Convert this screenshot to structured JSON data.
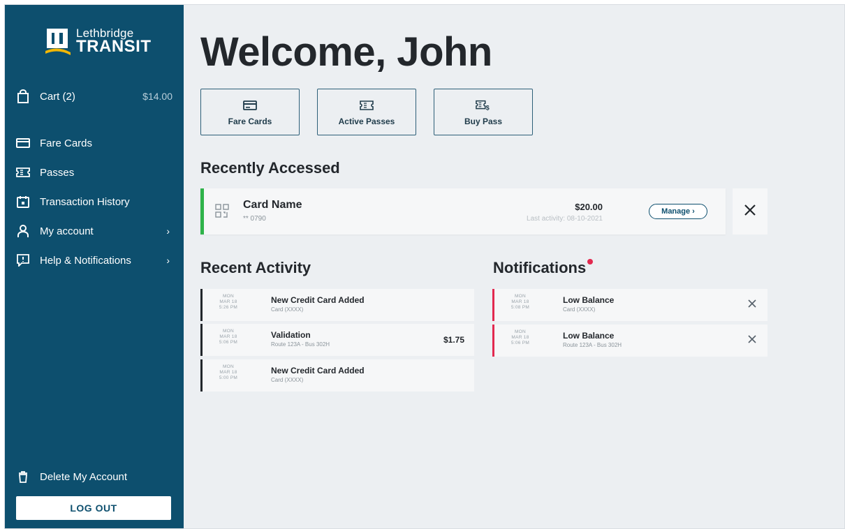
{
  "brand": {
    "logo_top": "Lethbridge",
    "logo_bottom": "TRANSIT",
    "primary_color": "#0d4f6e",
    "accent_yellow": "#f2b705"
  },
  "sidebar": {
    "cart": {
      "label": "Cart (2)",
      "amount": "$14.00",
      "icon": "shopping-bag-icon"
    },
    "items": [
      {
        "label": "Fare Cards",
        "icon": "card-icon",
        "chevron": false
      },
      {
        "label": "Passes",
        "icon": "ticket-icon",
        "chevron": false
      },
      {
        "label": "Transaction History",
        "icon": "calendar-icon",
        "chevron": false
      },
      {
        "label": "My account",
        "icon": "user-icon",
        "chevron": true,
        "chevron_glyph": "›"
      },
      {
        "label": "Help & Notifications",
        "icon": "help-bubble-icon",
        "chevron": true,
        "chevron_glyph": "›"
      }
    ],
    "delete_account": {
      "label": "Delete My Account",
      "icon": "trash-icon"
    },
    "logout_label": "LOG OUT"
  },
  "main": {
    "welcome": "Welcome, John",
    "quick_actions": [
      {
        "label": "Fare Cards",
        "icon": "card-icon"
      },
      {
        "label": "Active Passes",
        "icon": "ticket-icon"
      },
      {
        "label": "Buy Pass",
        "icon": "ticket-dollar-icon"
      }
    ],
    "recently_accessed": {
      "title": "Recently Accessed",
      "card_name": "Card Name",
      "card_number": "** 0790",
      "balance": "$20.00",
      "last_activity": "Last activity: 08-10-2021",
      "manage_label": "Manage ›",
      "status_color": "#2fb34a"
    },
    "recent_activity": {
      "title": "Recent Activity",
      "items": [
        {
          "day": "MON",
          "date": "MAR 18",
          "time": "5:26 PM",
          "title": "New Credit Card Added",
          "subtitle": "Card (XXXX)",
          "amount": ""
        },
        {
          "day": "MON",
          "date": "MAR 18",
          "time": "5:06 PM",
          "title": "Validation",
          "subtitle": "Route 123A - Bus 302H",
          "amount": "$1.75"
        },
        {
          "day": "MON",
          "date": "MAR 18",
          "time": "5:00 PM",
          "title": "New Credit Card Added",
          "subtitle": "Card (XXXX)",
          "amount": ""
        }
      ]
    },
    "notifications": {
      "title": "Notifications",
      "badge_color": "#e2294f",
      "items": [
        {
          "day": "MON",
          "date": "MAR 18",
          "time": "5:08 PM",
          "title": "Low Balance",
          "subtitle": "Card (XXXX)"
        },
        {
          "day": "MON",
          "date": "MAR 18",
          "time": "5:06 PM",
          "title": "Low Balance",
          "subtitle": "Route 123A - Bus 302H"
        }
      ]
    }
  }
}
